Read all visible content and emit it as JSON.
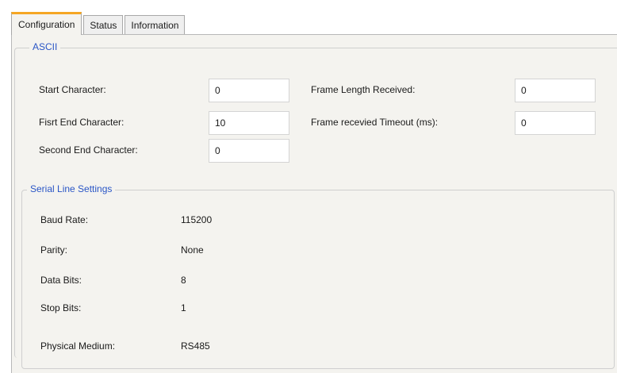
{
  "tabs": [
    {
      "label": "Configuration",
      "active": true
    },
    {
      "label": "Status",
      "active": false
    },
    {
      "label": "Information",
      "active": false
    }
  ],
  "ascii": {
    "title": "ASCII",
    "start_character": {
      "label": "Start Character:",
      "value": "0"
    },
    "first_end_character": {
      "label": "Fisrt End Character:",
      "value": "10"
    },
    "second_end_character": {
      "label": "Second End Character:",
      "value": "0"
    },
    "frame_length_received": {
      "label": "Frame Length Received:",
      "value": "0"
    },
    "frame_received_timeout": {
      "label": "Frame recevied Timeout (ms):",
      "value": "0"
    }
  },
  "serial": {
    "title": "Serial Line Settings",
    "baud_rate": {
      "label": "Baud Rate:",
      "value": "115200"
    },
    "parity": {
      "label": "Parity:",
      "value": "None"
    },
    "data_bits": {
      "label": "Data Bits:",
      "value": "8"
    },
    "stop_bits": {
      "label": "Stop Bits:",
      "value": "1"
    },
    "physical_medium": {
      "label": "Physical Medium:",
      "value": "RS485"
    }
  },
  "colors": {
    "accent_tab": "#f5a623",
    "group_title": "#2a56c6",
    "panel_bg": "#f4f3ef"
  }
}
